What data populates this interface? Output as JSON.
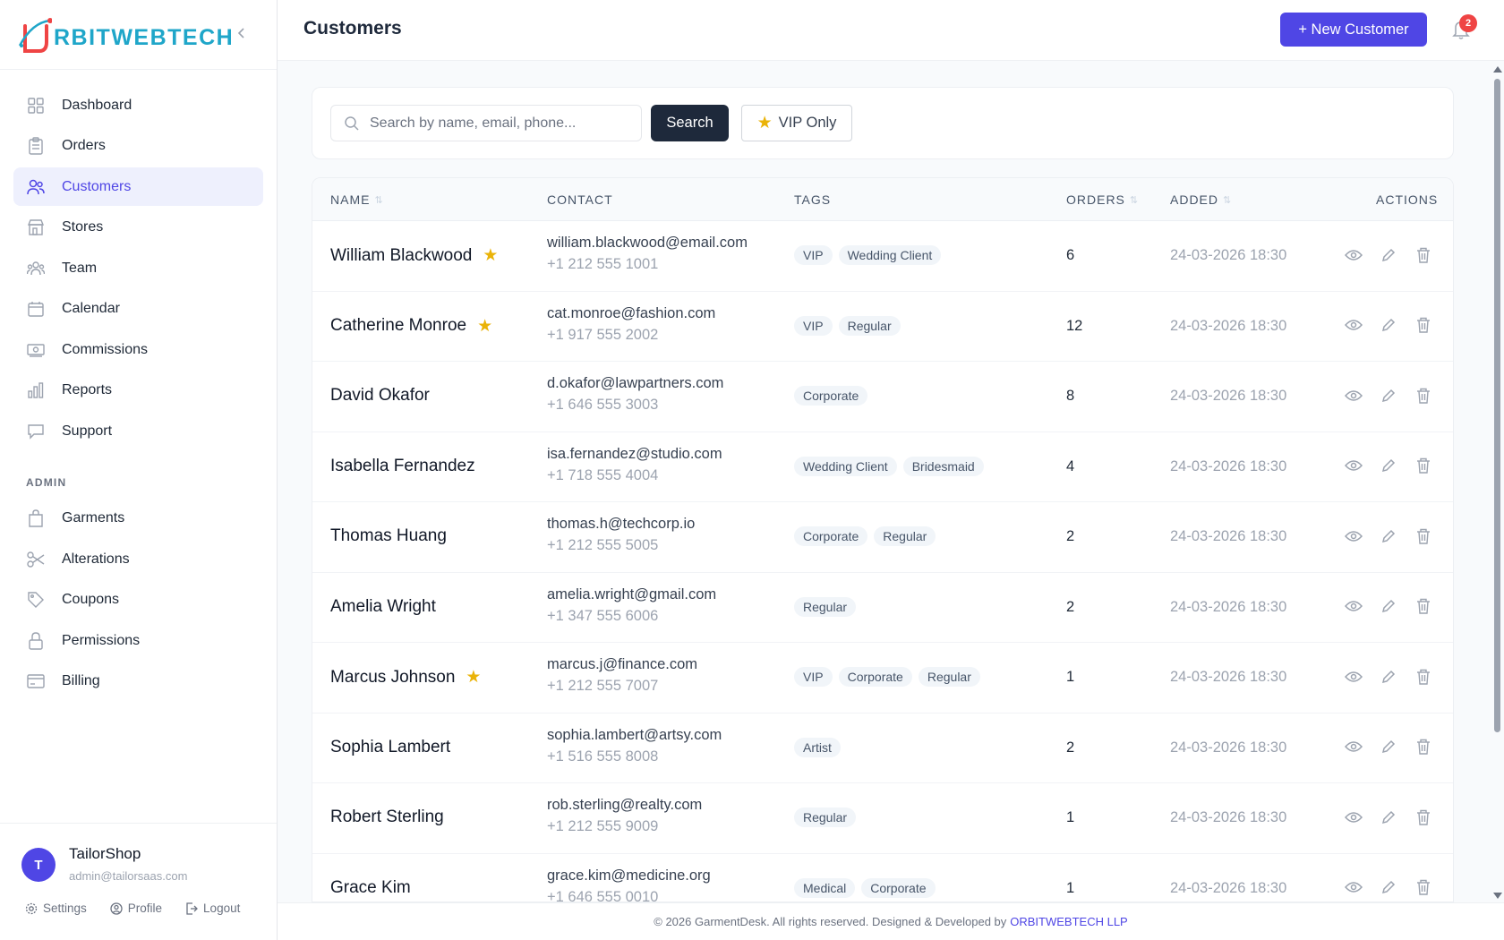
{
  "brand": {
    "name": "RBITWEBTECH",
    "accent": "#1fa6c9",
    "mark_color": "#ef4444"
  },
  "sidebar": {
    "items": [
      {
        "label": "Dashboard",
        "icon": "grid-icon"
      },
      {
        "label": "Orders",
        "icon": "clipboard-icon"
      },
      {
        "label": "Customers",
        "icon": "users-icon",
        "active": true
      },
      {
        "label": "Stores",
        "icon": "store-icon"
      },
      {
        "label": "Team",
        "icon": "team-icon"
      },
      {
        "label": "Calendar",
        "icon": "calendar-icon"
      },
      {
        "label": "Commissions",
        "icon": "money-icon"
      },
      {
        "label": "Reports",
        "icon": "bar-chart-icon"
      },
      {
        "label": "Support",
        "icon": "chat-icon"
      }
    ],
    "admin_label": "ADMIN",
    "admin_items": [
      {
        "label": "Garments",
        "icon": "bag-icon"
      },
      {
        "label": "Alterations",
        "icon": "scissors-icon"
      },
      {
        "label": "Coupons",
        "icon": "tag-icon"
      },
      {
        "label": "Permissions",
        "icon": "lock-icon"
      },
      {
        "label": "Billing",
        "icon": "card-icon"
      }
    ]
  },
  "user": {
    "initial": "T",
    "name": "TailorShop",
    "email": "admin@tailorsaas.com",
    "settings": "Settings",
    "profile": "Profile",
    "logout": "Logout"
  },
  "header": {
    "title": "Customers",
    "new_button": "+ New Customer",
    "notifications": "2"
  },
  "filters": {
    "search_placeholder": "Search by name, email, phone...",
    "search_button": "Search",
    "vip_button": "VIP Only"
  },
  "table": {
    "columns": {
      "name": "NAME",
      "contact": "CONTACT",
      "tags": "TAGS",
      "orders": "ORDERS",
      "added": "ADDED",
      "actions": "ACTIONS"
    },
    "rows": [
      {
        "name": "William Blackwood",
        "vip": true,
        "email": "william.blackwood@email.com",
        "phone": "+1 212 555 1001",
        "tags": [
          "VIP",
          "Wedding Client"
        ],
        "orders": "6",
        "added": "24-03-2026 18:30"
      },
      {
        "name": "Catherine Monroe",
        "vip": true,
        "email": "cat.monroe@fashion.com",
        "phone": "+1 917 555 2002",
        "tags": [
          "VIP",
          "Regular"
        ],
        "orders": "12",
        "added": "24-03-2026 18:30"
      },
      {
        "name": "David Okafor",
        "vip": false,
        "email": "d.okafor@lawpartners.com",
        "phone": "+1 646 555 3003",
        "tags": [
          "Corporate"
        ],
        "orders": "8",
        "added": "24-03-2026 18:30"
      },
      {
        "name": "Isabella Fernandez",
        "vip": false,
        "email": "isa.fernandez@studio.com",
        "phone": "+1 718 555 4004",
        "tags": [
          "Wedding Client",
          "Bridesmaid"
        ],
        "orders": "4",
        "added": "24-03-2026 18:30"
      },
      {
        "name": "Thomas Huang",
        "vip": false,
        "email": "thomas.h@techcorp.io",
        "phone": "+1 212 555 5005",
        "tags": [
          "Corporate",
          "Regular"
        ],
        "orders": "2",
        "added": "24-03-2026 18:30"
      },
      {
        "name": "Amelia Wright",
        "vip": false,
        "email": "amelia.wright@gmail.com",
        "phone": "+1 347 555 6006",
        "tags": [
          "Regular"
        ],
        "orders": "2",
        "added": "24-03-2026 18:30"
      },
      {
        "name": "Marcus Johnson",
        "vip": true,
        "email": "marcus.j@finance.com",
        "phone": "+1 212 555 7007",
        "tags": [
          "VIP",
          "Corporate",
          "Regular"
        ],
        "orders": "1",
        "added": "24-03-2026 18:30"
      },
      {
        "name": "Sophia Lambert",
        "vip": false,
        "email": "sophia.lambert@artsy.com",
        "phone": "+1 516 555 8008",
        "tags": [
          "Artist"
        ],
        "orders": "2",
        "added": "24-03-2026 18:30"
      },
      {
        "name": "Robert Sterling",
        "vip": false,
        "email": "rob.sterling@realty.com",
        "phone": "+1 212 555 9009",
        "tags": [
          "Regular"
        ],
        "orders": "1",
        "added": "24-03-2026 18:30"
      },
      {
        "name": "Grace Kim",
        "vip": false,
        "email": "grace.kim@medicine.org",
        "phone": "+1 646 555 0010",
        "tags": [
          "Medical",
          "Corporate"
        ],
        "orders": "1",
        "added": "24-03-2026 18:30"
      }
    ]
  },
  "footer": {
    "text": "© 2026 GarmentDesk. All rights reserved. Designed & Developed by",
    "link": "ORBITWEBTECH LLP"
  },
  "colors": {
    "primary": "#4f46e5",
    "dark_button": "#1e293b",
    "star": "#eab308",
    "badge": "#ef4444"
  }
}
